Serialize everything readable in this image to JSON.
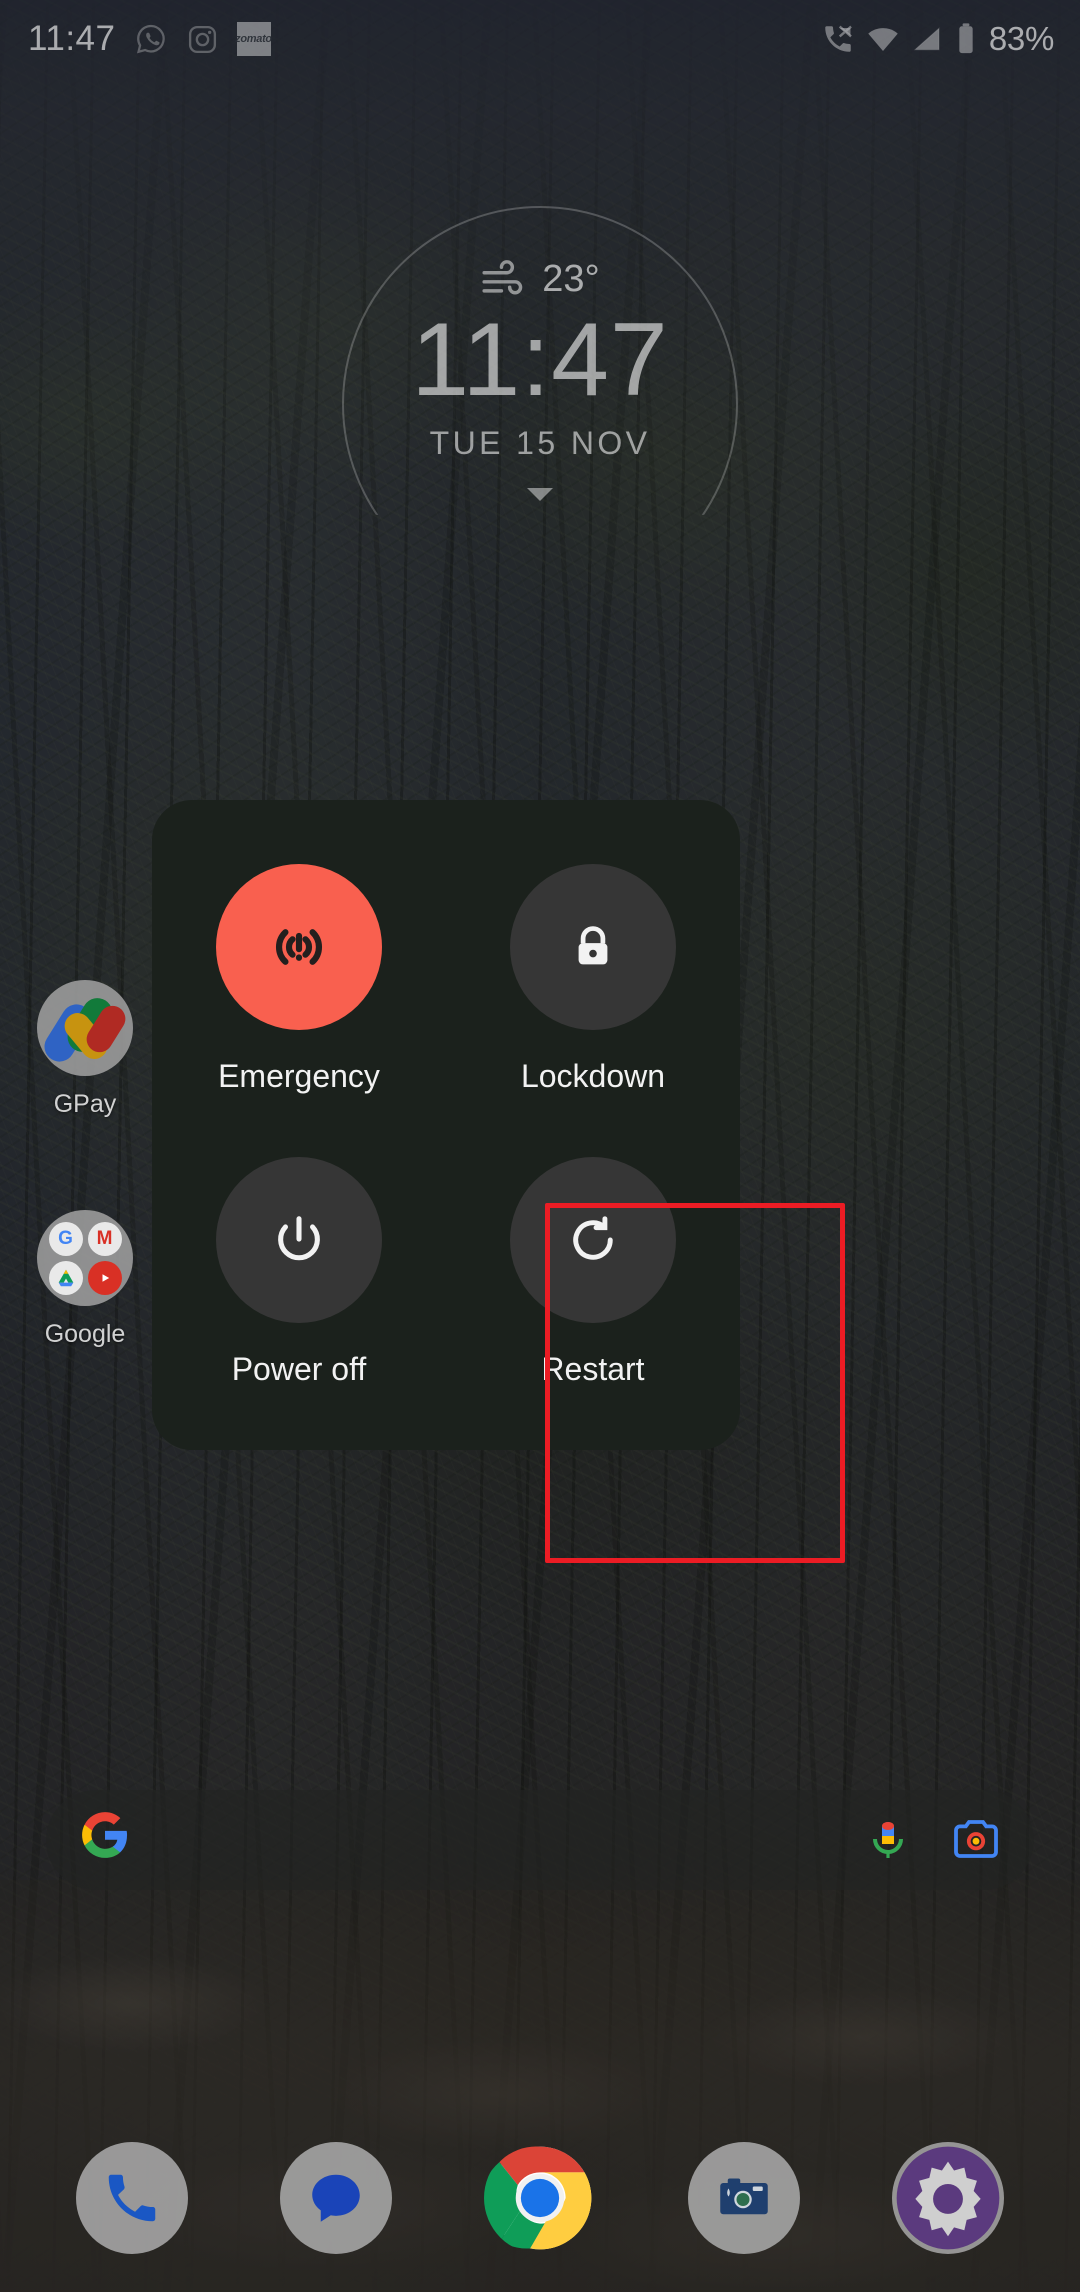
{
  "status_bar": {
    "clock": "11:47",
    "battery_percent": "83%",
    "notification_icons": [
      "whatsapp-icon",
      "instagram-icon",
      "zomato-icon"
    ],
    "zomato_label": "zomato",
    "right_icons": [
      "call-signal-icon",
      "wifi-icon",
      "cellular-signal-icon",
      "battery-icon"
    ]
  },
  "widget": {
    "temperature": "23°",
    "weather_icon": "windy-icon",
    "time": "11:47",
    "date": "TUE  15  NOV",
    "expand_icon": "caret-down-icon"
  },
  "home_apps": [
    {
      "name": "gpay",
      "label": "GPay",
      "icon": "gpay-icon"
    },
    {
      "name": "google-folder",
      "label": "Google",
      "icon": "google-folder-icon"
    }
  ],
  "search_bar": {
    "logo": "G",
    "mic_icon": "microphone-icon",
    "lens_icon": "google-lens-icon"
  },
  "dock": [
    {
      "name": "phone",
      "icon": "phone-icon"
    },
    {
      "name": "messages",
      "icon": "messages-icon"
    },
    {
      "name": "chrome",
      "icon": "chrome-icon"
    },
    {
      "name": "camera",
      "icon": "camera-icon"
    },
    {
      "name": "settings",
      "icon": "settings-gear-icon"
    }
  ],
  "power_menu": {
    "items": [
      {
        "name": "emergency",
        "label": "Emergency",
        "icon": "emergency-broadcast-icon",
        "circle_color": "#f9604f"
      },
      {
        "name": "lockdown",
        "label": "Lockdown",
        "icon": "lock-icon",
        "circle_color": "#363636"
      },
      {
        "name": "power-off",
        "label": "Power off",
        "icon": "power-icon",
        "circle_color": "#363636"
      },
      {
        "name": "restart",
        "label": "Restart",
        "icon": "restart-rotate-icon",
        "circle_color": "#363636"
      }
    ],
    "panel_color": "#1b211c",
    "highlighted_item": "restart",
    "highlight_color": "#ec1c24"
  }
}
